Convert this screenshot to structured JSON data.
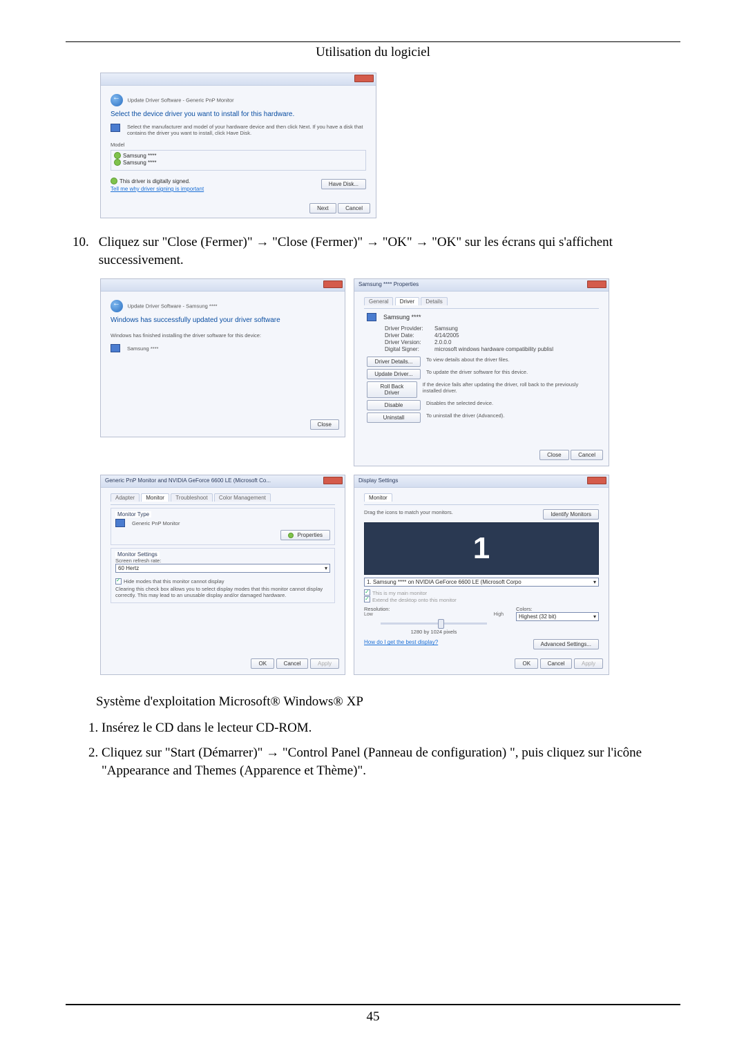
{
  "header": {
    "title": "Utilisation du logiciel"
  },
  "page_number": "45",
  "dialog1": {
    "breadcrumb": "Update Driver Software - Generic PnP Monitor",
    "heading": "Select the device driver you want to install for this hardware.",
    "sub": "Select the manufacturer and model of your hardware device and then click Next. If you have a disk that contains the driver you want to install, click Have Disk.",
    "model_label": "Model",
    "model_rows": [
      "Samsung ****",
      "Samsung ****"
    ],
    "signed": "This driver is digitally signed.",
    "signed_link": "Tell me why driver signing is important",
    "have_disk": "Have Disk...",
    "next": "Next",
    "cancel": "Cancel"
  },
  "steps_top": {
    "num": "10.",
    "text_parts": [
      "Cliquez sur \"Close (Fermer)\" → \"Close (Fermer)\" → \"OK\" → \"OK\" sur les écrans qui s'affichent successivement."
    ]
  },
  "quad": {
    "a": {
      "breadcrumb": "Update Driver Software - Samsung ****",
      "heading": "Windows has successfully updated your driver software",
      "line": "Windows has finished installing the driver software for this device:",
      "dev": "Samsung ****",
      "close": "Close"
    },
    "b": {
      "title": "Samsung **** Properties",
      "tabs": [
        "General",
        "Driver",
        "Details"
      ],
      "dev": "Samsung ****",
      "rows": [
        {
          "k": "Driver Provider:",
          "v": "Samsung"
        },
        {
          "k": "Driver Date:",
          "v": "4/14/2005"
        },
        {
          "k": "Driver Version:",
          "v": "2.0.0.0"
        },
        {
          "k": "Digital Signer:",
          "v": "microsoft windows hardware compatibility publisl"
        }
      ],
      "btns": [
        {
          "b": "Driver Details...",
          "d": "To view details about the driver files."
        },
        {
          "b": "Update Driver...",
          "d": "To update the driver software for this device."
        },
        {
          "b": "Roll Back Driver",
          "d": "If the device fails after updating the driver, roll back to the previously installed driver."
        },
        {
          "b": "Disable",
          "d": "Disables the selected device."
        },
        {
          "b": "Uninstall",
          "d": "To uninstall the driver (Advanced)."
        }
      ],
      "close": "Close",
      "cancel": "Cancel"
    },
    "c": {
      "title": "Generic PnP Monitor and NVIDIA GeForce 6600 LE (Microsoft Co...",
      "tabs": [
        "Adapter",
        "Monitor",
        "Troubleshoot",
        "Color Management"
      ],
      "mt_label": "Monitor Type",
      "mt_value": "Generic PnP Monitor",
      "props": "Properties",
      "ms_label": "Monitor Settings",
      "refresh_label": "Screen refresh rate:",
      "refresh_val": "60 Hertz",
      "hide": "Hide modes that this monitor cannot display",
      "hide_desc": "Clearing this check box allows you to select display modes that this monitor cannot display correctly. This may lead to an unusable display and/or damaged hardware.",
      "ok": "OK",
      "cancel": "Cancel",
      "apply": "Apply"
    },
    "d": {
      "title": "Display Settings",
      "tab": "Monitor",
      "drag": "Drag the icons to match your monitors.",
      "identify": "Identify Monitors",
      "big": "1",
      "sel": "1. Samsung **** on NVIDIA GeForce 6600 LE (Microsoft Corpo",
      "main": "This is my main monitor",
      "extend": "Extend the desktop onto this monitor",
      "res_label": "Resolution:",
      "low": "Low",
      "high": "High",
      "res_val": "1280 by 1024 pixels",
      "colors_label": "Colors:",
      "colors_val": "Highest (32 bit)",
      "best": "How do I get the best display?",
      "adv": "Advanced Settings...",
      "ok": "OK",
      "cancel": "Cancel",
      "apply": "Apply"
    }
  },
  "os_line": "Système d'exploitation Microsoft® Windows® XP",
  "steps_bottom": [
    "Insérez le CD dans le lecteur CD-ROM.",
    "Cliquez sur \"Start (Démarrer)\" → \"Control Panel (Panneau de configuration) \", puis cliquez sur l'icône \"Appearance and Themes (Apparence et Thème)\"."
  ]
}
